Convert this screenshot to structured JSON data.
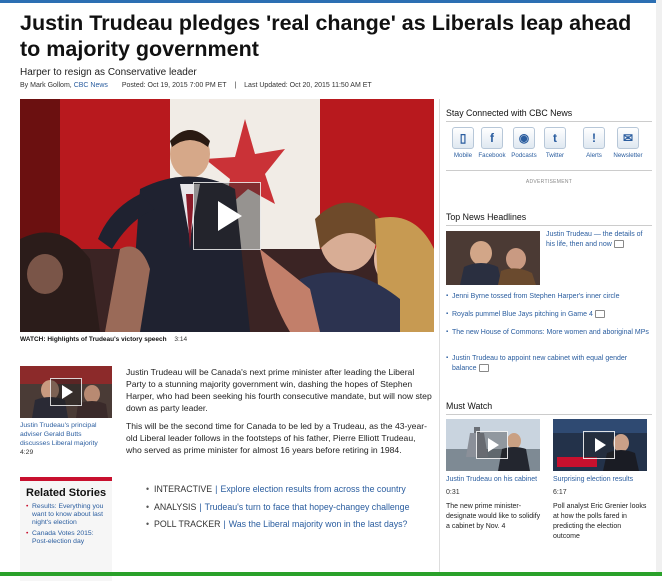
{
  "article": {
    "title": "Justin Trudeau pledges 'real change' as Liberals leap ahead to majority government",
    "subhead": "Harper to resign as Conservative leader",
    "byline_by": "By Mark Gollom,",
    "byline_source": "CBC News",
    "posted": "Posted: Oct 19, 2015 7:00 PM ET",
    "byline_sep": "|",
    "updated": "Last Updated: Oct 20, 2015 11:50 AM ET",
    "video_caption": "WATCH: Highlights of Trudeau's victory speech",
    "video_duration": "3:14",
    "paragraph1": "Justin Trudeau will be Canada's next prime minister after leading the Liberal Party to a stunning majority government win, dashing the hopes of Stephen Harper, who had been seeking his fourth consecutive mandate, but will now step down as party leader.",
    "paragraph2": "This will be the second time for Canada to be led by a Trudeau, as the 43-year-old Liberal leader follows in the footsteps of his father, Pierre Elliott Trudeau, who served as prime minister for almost 16 years before retiring in 1984.",
    "links": [
      {
        "tag": "INTERACTIVE",
        "sep": "|",
        "text": "Explore election results from across the country"
      },
      {
        "tag": "ANALYSIS",
        "sep": "|",
        "text": "Trudeau's turn to face that hopey-changey challenge"
      },
      {
        "tag": "POLL TRACKER",
        "sep": "|",
        "text": "Was the Liberal majority won in the last days?"
      }
    ]
  },
  "side_video": {
    "caption": "Justin Trudeau's principal adviser Gerald Butts discusses Liberal majority",
    "duration": "4:29"
  },
  "related": {
    "heading": "Related Stories",
    "items": [
      "Results: Everything you want to know about last night's election",
      "Canada Votes 2015: Post-election day"
    ]
  },
  "sidebar": {
    "stay_connected": "Stay Connected with CBC News",
    "social": [
      {
        "label": "Mobile",
        "icon": "mobile-icon",
        "glyph": "▯"
      },
      {
        "label": "Facebook",
        "icon": "facebook-icon",
        "glyph": "f"
      },
      {
        "label": "Podcasts",
        "icon": "podcast-icon",
        "glyph": "◉"
      },
      {
        "label": "Twitter",
        "icon": "twitter-icon",
        "glyph": "t"
      },
      {
        "label": "Alerts",
        "icon": "alert-icon",
        "glyph": "!"
      },
      {
        "label": "Newsletter",
        "icon": "envelope-icon",
        "glyph": "✉"
      }
    ],
    "advertisement": "ADVERTISEMENT",
    "top_news": "Top News Headlines",
    "lead_headline": "Justin Trudeau — the details of his life, then and now",
    "headlines": [
      "Jenni Byrne tossed from Stephen Harper's inner circle",
      "Royals pummel Blue Jays pitching in Game 4",
      "The new House of Commons: More women and aboriginal MPs",
      "Justin Trudeau to appoint new cabinet with equal gender balance"
    ],
    "must_watch": "Must Watch",
    "videos": [
      {
        "title": "Justin Trudeau on his cabinet",
        "duration": "0:31",
        "description": "The new prime minister-designate would like to solidify a cabinet by Nov. 4"
      },
      {
        "title": "Surprising election results",
        "duration": "6:17",
        "description": "Poll analyst Eric Grenier looks at how the polls fared in predicting the election outcome"
      }
    ]
  },
  "colors": {
    "link": "#2a5d9f",
    "accent_red": "#c8102e",
    "brand_bar": "#2c6fb3"
  }
}
